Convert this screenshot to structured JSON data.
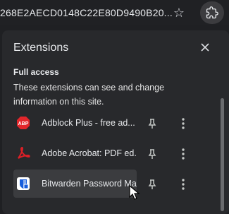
{
  "address_bar": {
    "url_text": "268E2AECD0148C22E80D9490B20..."
  },
  "panel": {
    "title": "Extensions",
    "section_title": "Full access",
    "section_desc": "These extensions can see and change information on this site.",
    "extensions": [
      {
        "name": "Adblock Plus - free ad...",
        "icon": "adblock-plus-icon"
      },
      {
        "name": "Adobe Acrobat: PDF ed...",
        "icon": "adobe-acrobat-icon"
      },
      {
        "name": "Bitwarden Password Ma...",
        "icon": "bitwarden-icon"
      }
    ]
  },
  "colors": {
    "background": "#1f2023",
    "panel": "#28292c",
    "hover_row": "#3b3c3f",
    "adblock_red": "#e2262b",
    "acrobat_red": "#dc1f26",
    "bitwarden_blue": "#175ddc"
  }
}
